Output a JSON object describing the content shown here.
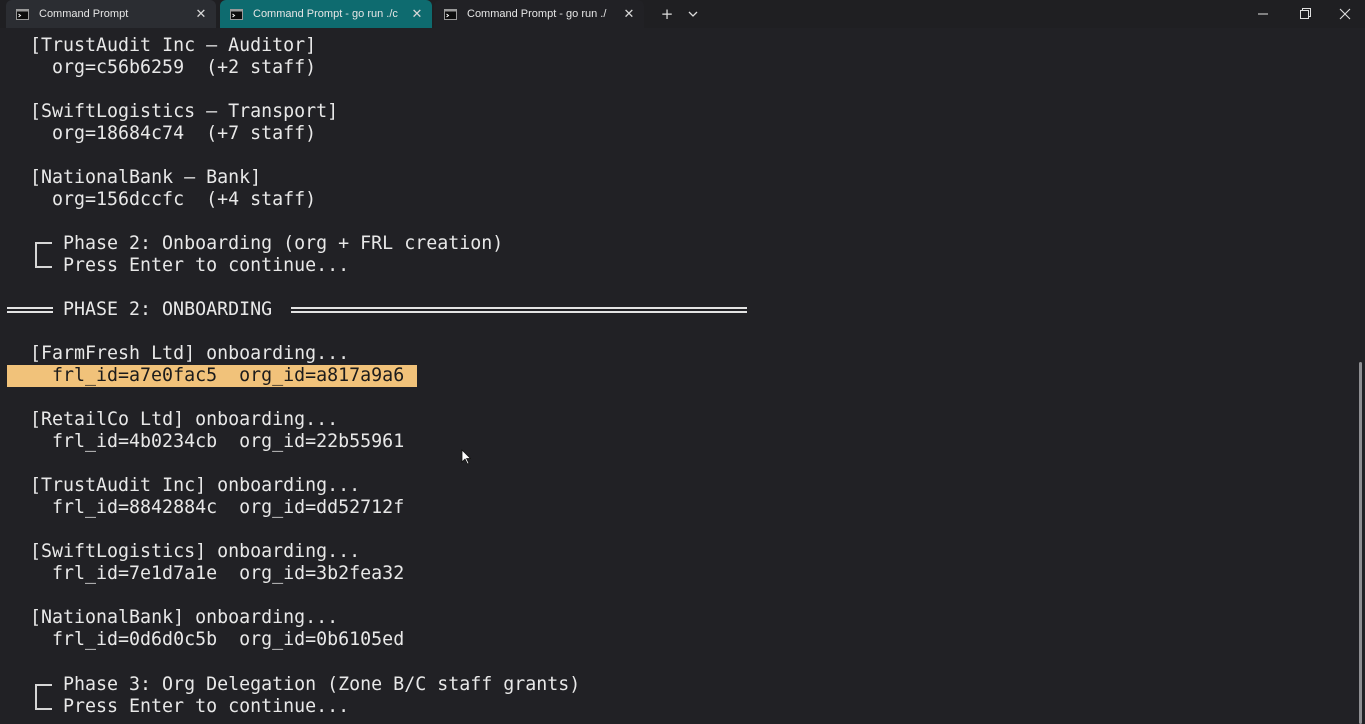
{
  "tabs": [
    {
      "label": "Command Prompt",
      "close": "✕"
    },
    {
      "label": "Command Prompt - go  run ./c",
      "close": "✕"
    },
    {
      "label": "Command Prompt - go  run ./",
      "close": "✕"
    }
  ],
  "new_tab": "+",
  "terminal": {
    "line_auditor_header": "[TrustAudit Inc – Auditor]",
    "line_auditor_org": "org=c56b6259  (+2 staff)",
    "line_transport_header": "[SwiftLogistics – Transport]",
    "line_transport_org": "org=18684c74  (+7 staff)",
    "line_bank_header": "[NationalBank – Bank]",
    "line_bank_org": "org=156dccfc  (+4 staff)",
    "phase2_prompt_title": "Phase 2: Onboarding (org + FRL creation)",
    "phase2_prompt_enter": "Press Enter to continue...",
    "phase2_banner": "PHASE 2: ONBOARDING",
    "onboard": [
      {
        "header": "[FarmFresh Ltd] onboarding...",
        "ids": "frl_id=a7e0fac5  org_id=a817a9a6"
      },
      {
        "header": "[RetailCo Ltd] onboarding...",
        "ids": "frl_id=4b0234cb  org_id=22b55961"
      },
      {
        "header": "[TrustAudit Inc] onboarding...",
        "ids": "frl_id=8842884c  org_id=dd52712f"
      },
      {
        "header": "[SwiftLogistics] onboarding...",
        "ids": "frl_id=7e1d7a1e  org_id=3b2fea32"
      },
      {
        "header": "[NationalBank] onboarding...",
        "ids": "frl_id=0d6d0c5b  org_id=0b6105ed"
      }
    ],
    "phase3_prompt_title": "Phase 3: Org Delegation (Zone B/C staff grants)",
    "phase3_prompt_enter": "Press Enter to continue..."
  },
  "colors": {
    "terminal_bg": "#212125",
    "active_tab": "#0e6b6f",
    "highlight": "#f1c27a"
  }
}
